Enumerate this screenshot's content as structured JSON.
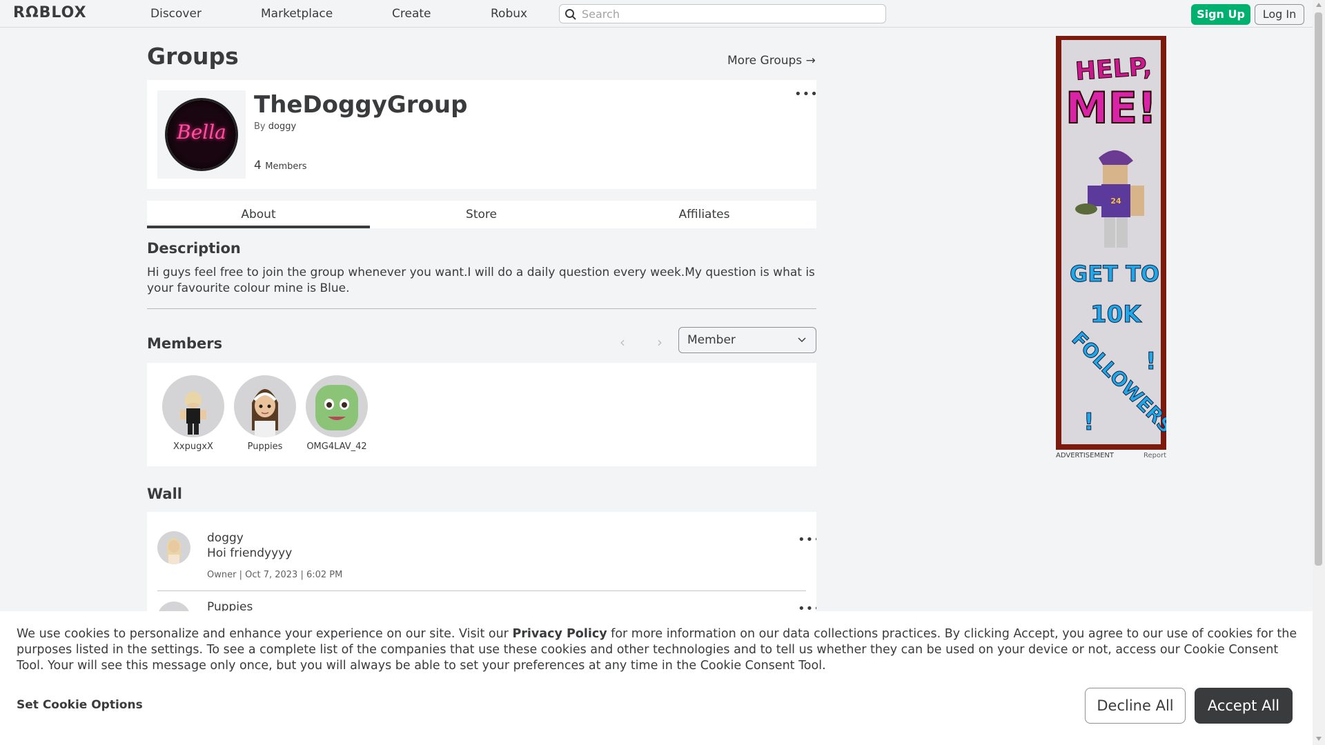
{
  "nav": {
    "logo": "RΩBLOX",
    "links": [
      "Discover",
      "Marketplace",
      "Create",
      "Robux"
    ],
    "search_placeholder": "Search",
    "signup_label": "Sign Up",
    "login_label": "Log In"
  },
  "page": {
    "title": "Groups",
    "more_groups": "More Groups →"
  },
  "group": {
    "emblem_text": "Bella",
    "name": "TheDoggyGroup",
    "by_prefix": "By",
    "owner": "doggy",
    "member_count": "4",
    "member_label": "Members",
    "menu": "•••"
  },
  "tabs": [
    "About",
    "Store",
    "Affiliates"
  ],
  "description": {
    "heading": "Description",
    "text": "Hi guys feel free to join the group whenever you want.I will do a daily question every week.My question is what is your favourite colour mine is Blue."
  },
  "members": {
    "heading": "Members",
    "prev": "‹",
    "next": "›",
    "role_selected": "Member",
    "list": [
      {
        "name": "XxpugxX"
      },
      {
        "name": "Puppies"
      },
      {
        "name": "OMG4LAV_42"
      }
    ]
  },
  "wall": {
    "heading": "Wall",
    "posts": [
      {
        "user": "doggy",
        "body": "Hoi friendyyyy",
        "meta": "Owner | Oct 7, 2023 | 6:02 PM",
        "menu": "•••"
      },
      {
        "user": "Puppies",
        "body": "",
        "meta": "",
        "menu": "•••"
      }
    ]
  },
  "ad": {
    "lines": [
      "HELP,",
      "ME!",
      "GET TO",
      "10K",
      "FOLLOWERS",
      "!",
      "!"
    ],
    "label": "ADVERTISEMENT",
    "report": "Report"
  },
  "cookie": {
    "text_before": "We use cookies to personalize and enhance your experience on our site. Visit our ",
    "privacy_link": "Privacy Policy",
    "text_after": " for more information on our data collections practices. By clicking Accept, you agree to our use of cookies for the purposes listed in the settings. To see a complete list of the companies that use these cookies and other technologies and to tell us whether they can be used on your device or not, access our Cookie Consent Tool. Your will see this message only once, but you will always be able to set your preferences at any time in the Cookie Consent Tool.",
    "options_label": "Set Cookie Options",
    "decline_label": "Decline All",
    "accept_label": "Accept All"
  },
  "colors": {
    "accent_green": "#00b06f",
    "text": "#393b3d",
    "background": "#f2f4f5",
    "card": "#ffffff"
  }
}
